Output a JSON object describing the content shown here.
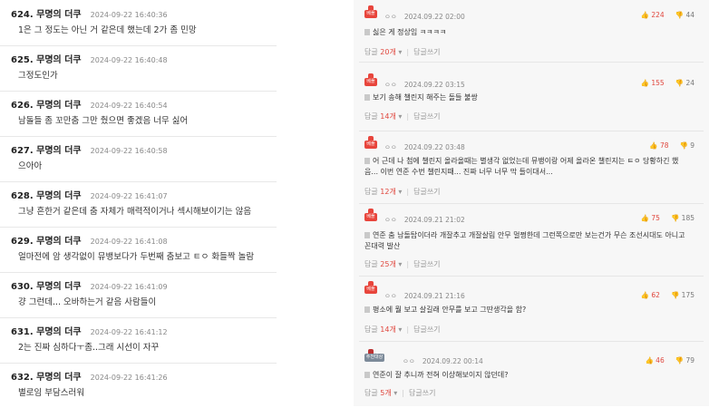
{
  "left_posts": [
    {
      "num": "624. 무명의 더쿠",
      "date": "2024-09-22 16:40:36",
      "body": "1은 그 정도는 아닌 거 같은데 했는데 2가 좀 민망"
    },
    {
      "num": "625. 무명의 더쿠",
      "date": "2024-09-22 16:40:48",
      "body": "그정도인가"
    },
    {
      "num": "626. 무명의 더쿠",
      "date": "2024-09-22 16:40:54",
      "body": "남돌들 좀 꼬만춤 그만 췄으면 좋겠음 너무 싫어"
    },
    {
      "num": "627. 무명의 더쿠",
      "date": "2024-09-22 16:40:58",
      "body": "으아아"
    },
    {
      "num": "628. 무명의 더쿠",
      "date": "2024-09-22 16:41:07",
      "body": "그냥 흔한거 같은데 춤 자체가 매력적이거나 섹시해보이기는 않음"
    },
    {
      "num": "629. 무명의 더쿠",
      "date": "2024-09-22 16:41:08",
      "body": "얼마전에 암 생각없이 뮤뱅보다가 두번째 춤보고 ㅌㅇ 화들짝 놀람"
    },
    {
      "num": "630. 무명의 더쿠",
      "date": "2024-09-22 16:41:09",
      "body": "걍 그런데... 오바하는거 같음 사람들이"
    },
    {
      "num": "631. 무명의 더쿠",
      "date": "2024-09-22 16:41:12",
      "body": "2는 진짜 심하다ㅜ좀..그래 시선이 자꾸"
    },
    {
      "num": "632. 무명의 더쿠",
      "date": "2024-09-22 16:41:26",
      "body": "별로임 부담스러워"
    }
  ],
  "right_comments": [
    {
      "badge": "베플",
      "user": "ㅇㅇ",
      "date": "2024.09.22 02:00",
      "up": "224",
      "down": "44",
      "body": "싫은 게 정상임 ㅋㅋㅋㅋ",
      "reply_label": "답글",
      "reply_count": "20개",
      "reply_write": "답글쓰기"
    },
    {
      "badge": "베플",
      "user": "ㅇㅇ",
      "date": "2024.09.22 03:15",
      "up": "155",
      "down": "24",
      "body": "보기 송해 챌린지 해주는 돌들 불쌍",
      "reply_label": "답글",
      "reply_count": "14개",
      "reply_write": "답글쓰기"
    },
    {
      "badge": "베플",
      "user": "ㅇㅇ",
      "date": "2024.09.22 03:48",
      "up": "78",
      "down": "9",
      "body": "어 근데 나 첨에 챌린지 올라올때는 별생각 없었는데 뮤뱅이랑 어제 올라온 챌린지는 ㅌㅇ 당황하긴 했음... 이번 연준 수번 챌린지때... 진짜 너무 너무 막 들이대서...",
      "reply_label": "답글",
      "reply_count": "12개",
      "reply_write": "답글쓰기"
    },
    {
      "badge": "베플",
      "user": "ㅇㅇ",
      "date": "2024.09.21 21:02",
      "up": "75",
      "down": "185",
      "body": "연준 춤 남돌탑이더라 개잘추고 개잘살림 안무 멀쩡한데 그런쪽으로만 보는건가 무슨 조선시대도 아니고 꼰대력 발산",
      "reply_label": "답글",
      "reply_count": "25개",
      "reply_write": "답글쓰기"
    },
    {
      "badge": "베플",
      "user": "ㅇㅇ",
      "date": "2024.09.21 21:16",
      "up": "62",
      "down": "175",
      "body": "평소에 뭘 보고 살길래 안무를 보고 그딴생각을 함?",
      "reply_label": "답글",
      "reply_count": "14개",
      "reply_write": "답글쓰기"
    },
    {
      "badge": "추천대상",
      "user": "ㅇㅇ",
      "date": "2024.09.22 00:14",
      "up": "46",
      "down": "79",
      "body": "연준이 잘 추니까 전혀 이상해보이지 않던데?",
      "reply_label": "답글",
      "reply_count": "5개",
      "reply_write": "답글쓰기"
    }
  ],
  "colors": {
    "accent": "#e0483f",
    "badge": "#e8453c"
  }
}
